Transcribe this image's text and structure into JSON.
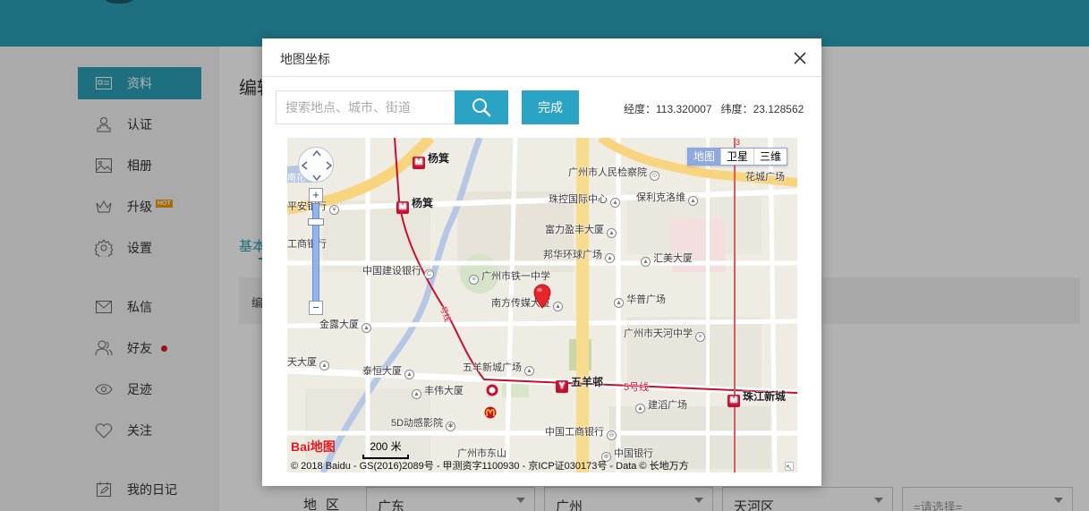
{
  "sidebar": {
    "items": [
      {
        "label": "资料",
        "icon": "profile-card-icon"
      },
      {
        "label": "认证",
        "icon": "certify-icon"
      },
      {
        "label": "相册",
        "icon": "image-icon"
      },
      {
        "label": "升级",
        "icon": "crown-icon",
        "badge": "HOT"
      },
      {
        "label": "设置",
        "icon": "gear-icon"
      },
      {
        "label": "私信",
        "icon": "mail-icon"
      },
      {
        "label": "好友",
        "icon": "friends-icon"
      },
      {
        "label": "足迹",
        "icon": "eye-icon"
      },
      {
        "label": "关注",
        "icon": "heart-icon"
      },
      {
        "label": "我的日记",
        "icon": "diary-icon"
      }
    ]
  },
  "background": {
    "title_fragment": "编辑",
    "tab_fragment": "基本",
    "bar_fragment": "编",
    "region": {
      "label": "地区",
      "province": "广东",
      "city": "广州",
      "district": "天河区",
      "placeholder": "=请选择="
    }
  },
  "modal": {
    "title": "地图坐标",
    "search_placeholder": "搜索地点、城市、街道",
    "done_label": "完成",
    "lng_label": "经度：",
    "lng_value": "113.320007",
    "lat_label": "纬度：",
    "lat_value": "23.128562"
  },
  "map": {
    "types": [
      "地图",
      "卫星",
      "三维"
    ],
    "labels": {
      "yangji1": "杨箕",
      "yangji2": "杨箕",
      "procuratorate": "广州市人民检察院",
      "zhuguang": "珠控国际中心",
      "poly": "保利克洛维",
      "fuli": "富力盈丰大厦",
      "banghua": "邦华环球广场",
      "huimei": "汇美大厦",
      "huacheng": "花城广场",
      "pingan": "平安银行",
      "icbc1": "工商银行",
      "ccb": "中国建设银行",
      "tieyi": "广州市铁一中学",
      "nanfang": "南方传媒大厦",
      "huapu": "华普广场",
      "jinlu": "金露大厦",
      "tianhe": "广州市天河中学",
      "tianda": "天大厦",
      "taiheng": "泰恒大厦",
      "wuyang_plaza": "五羊新城广场",
      "wuyangbang": "五羊邨",
      "line5": "5号线",
      "zhujiang": "珠江新城",
      "fengwei": "丰伟大厦",
      "jiantao": "建滔广场",
      "cinema": "5D动感影院",
      "icbc2": "中国工商银行",
      "bank_china": "中国银行",
      "dongshan": "广州市东山",
      "line_side": "号线",
      "huacheng_short": "南花",
      "line3": "3"
    },
    "logo": "Bai地图",
    "scale": "200 米",
    "copyright": "© 2018 Baidu - GS(2016)2089号 - 甲测资字1100930 - 京ICP证030173号 - Data © 长地万方"
  }
}
